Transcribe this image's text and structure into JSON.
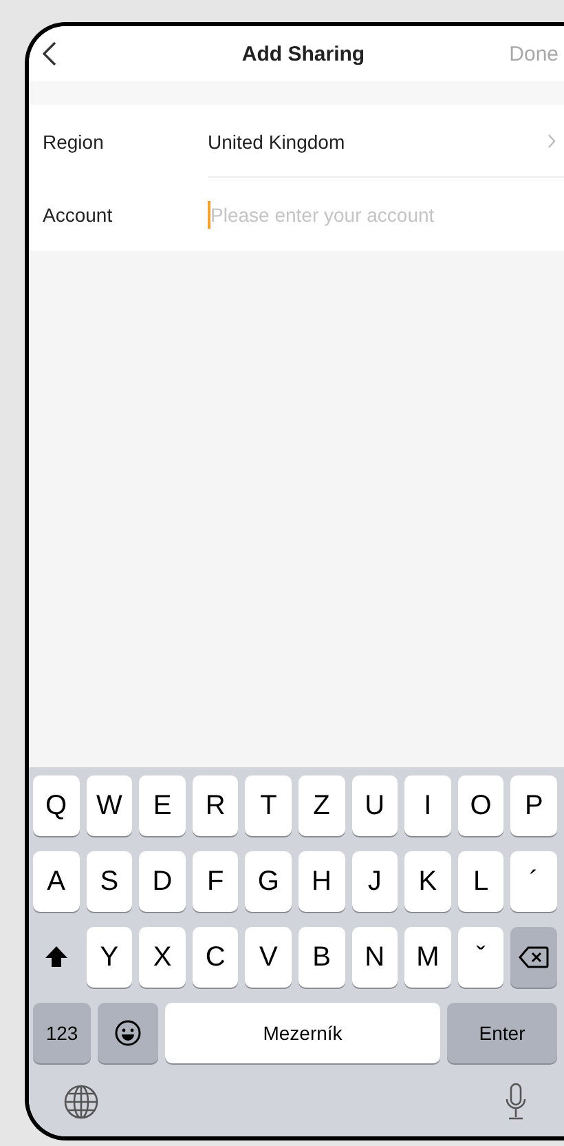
{
  "nav": {
    "title": "Add Sharing",
    "action": {
      "label": "Done",
      "disabled": true
    }
  },
  "form": [
    {
      "kind": "select",
      "label": "Region",
      "value": "United Kingdom"
    },
    {
      "kind": "input",
      "label": "Account",
      "placeholder": "Please enter your account",
      "focused": true
    }
  ],
  "keyboard": {
    "letter_rows": [
      [
        {
          "kind": "char",
          "label": "Q"
        },
        {
          "kind": "char",
          "label": "W"
        },
        {
          "kind": "char",
          "label": "E"
        },
        {
          "kind": "char",
          "label": "R"
        },
        {
          "kind": "char",
          "label": "T"
        },
        {
          "kind": "char",
          "label": "Z"
        },
        {
          "kind": "char",
          "label": "U"
        },
        {
          "kind": "char",
          "label": "I"
        },
        {
          "kind": "char",
          "label": "O"
        },
        {
          "kind": "char",
          "label": "P"
        }
      ],
      [
        {
          "kind": "char",
          "label": "A"
        },
        {
          "kind": "char",
          "label": "S"
        },
        {
          "kind": "char",
          "label": "D"
        },
        {
          "kind": "char",
          "label": "F"
        },
        {
          "kind": "char",
          "label": "G"
        },
        {
          "kind": "char",
          "label": "H"
        },
        {
          "kind": "char",
          "label": "J"
        },
        {
          "kind": "char",
          "label": "K"
        },
        {
          "kind": "char",
          "label": "L"
        },
        {
          "kind": "char",
          "label": "´"
        }
      ],
      [
        {
          "kind": "shift"
        },
        {
          "kind": "char",
          "label": "Y"
        },
        {
          "kind": "char",
          "label": "X"
        },
        {
          "kind": "char",
          "label": "C"
        },
        {
          "kind": "char",
          "label": "V"
        },
        {
          "kind": "char",
          "label": "B"
        },
        {
          "kind": "char",
          "label": "N"
        },
        {
          "kind": "char",
          "label": "M"
        },
        {
          "kind": "char",
          "label": "ˇ"
        },
        {
          "kind": "backspace"
        }
      ]
    ],
    "bottom_row": [
      {
        "kind": "mode",
        "label": "123"
      },
      {
        "kind": "emoji"
      },
      {
        "kind": "space",
        "label": "Mezerník"
      },
      {
        "kind": "enter",
        "label": "Enter"
      }
    ]
  }
}
